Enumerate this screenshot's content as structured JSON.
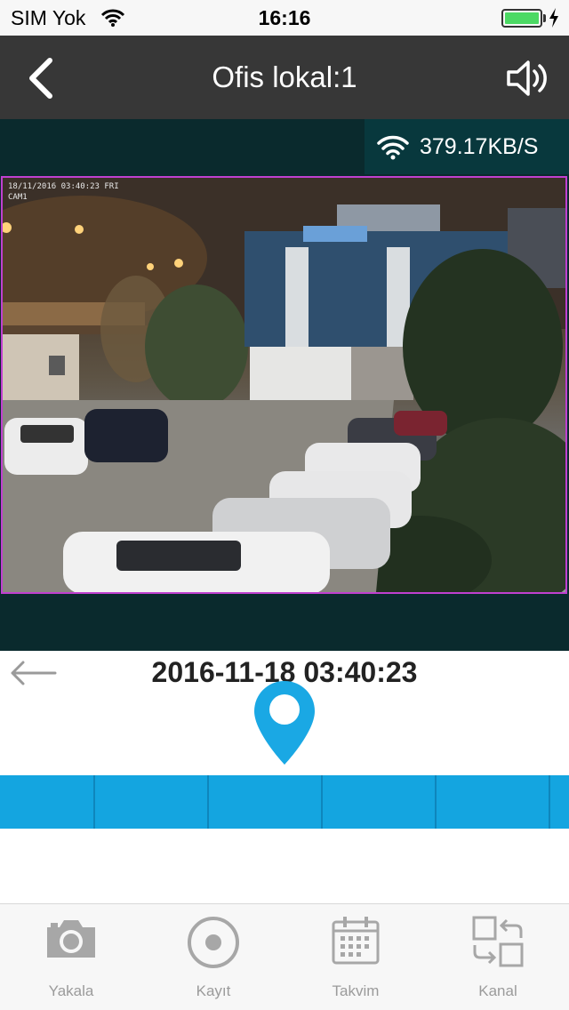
{
  "status_bar": {
    "carrier": "SIM Yok",
    "time": "16:16",
    "battery_level": 1.0,
    "charging": true
  },
  "nav": {
    "title": "Ofis lokal:1",
    "back_icon": "chevron-left-icon",
    "sound_icon": "speaker-icon"
  },
  "stream": {
    "speed": "379.17KB/S",
    "osd_timestamp": "18/11/2016 03:40:23 FRI",
    "osd_camera": "CAM1"
  },
  "timeline": {
    "date": "2016-11-18 03:40:23",
    "accent_color": "#14a5e0"
  },
  "tabs": [
    {
      "label": "Yakala",
      "icon": "camera-icon"
    },
    {
      "label": "Kayıt",
      "icon": "record-icon"
    },
    {
      "label": "Takvim",
      "icon": "calendar-icon"
    },
    {
      "label": "Kanal",
      "icon": "switch-channel-icon"
    }
  ]
}
